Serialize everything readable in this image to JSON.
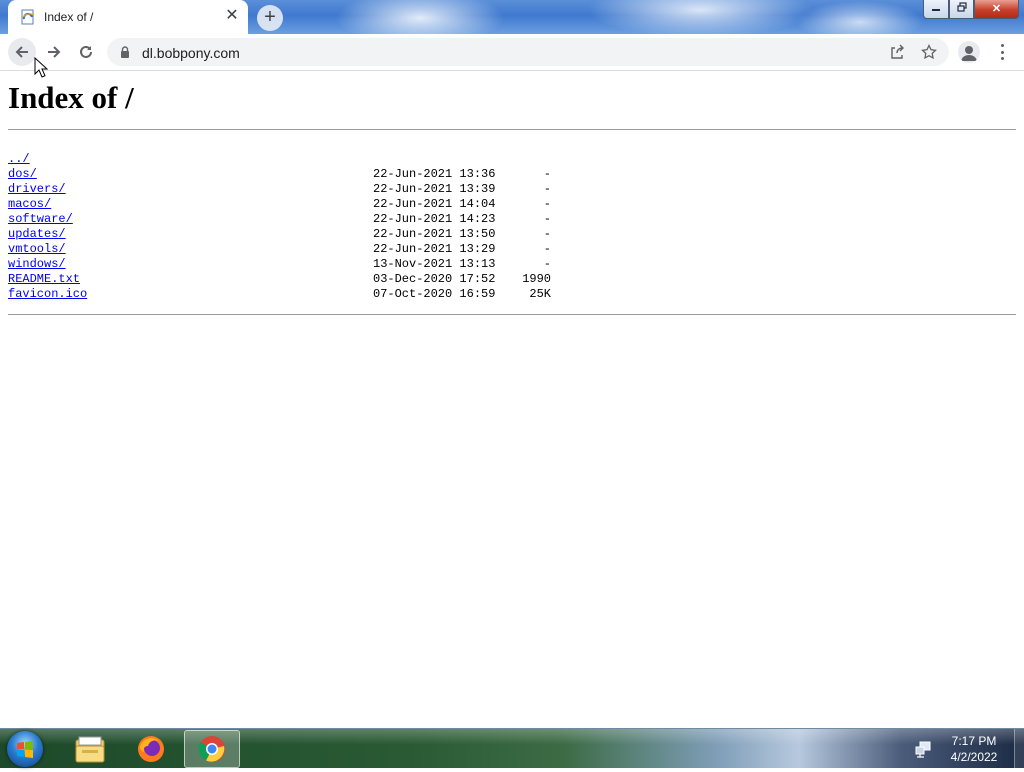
{
  "browser": {
    "tab": {
      "title": "Index of /",
      "favicon": "ie-document-icon"
    },
    "new_tab_label": "+",
    "omnibox": {
      "url": "dl.bobpony.com"
    },
    "window_controls": {
      "minimize": "minimize-icon",
      "maximize": "restore-icon",
      "close": "close-icon"
    }
  },
  "page": {
    "heading": "Index of /",
    "entries": [
      {
        "name": "../",
        "date": "",
        "size": ""
      },
      {
        "name": "dos/",
        "date": "22-Jun-2021 13:36",
        "size": "-"
      },
      {
        "name": "drivers/",
        "date": "22-Jun-2021 13:39",
        "size": "-"
      },
      {
        "name": "macos/",
        "date": "22-Jun-2021 14:04",
        "size": "-"
      },
      {
        "name": "software/",
        "date": "22-Jun-2021 14:23",
        "size": "-"
      },
      {
        "name": "updates/",
        "date": "22-Jun-2021 13:50",
        "size": "-"
      },
      {
        "name": "vmtools/",
        "date": "22-Jun-2021 13:29",
        "size": "-"
      },
      {
        "name": "windows/",
        "date": "13-Nov-2021 13:13",
        "size": "-"
      },
      {
        "name": "README.txt",
        "date": "03-Dec-2020 17:52",
        "size": "1990"
      },
      {
        "name": "favicon.ico",
        "date": "07-Oct-2020 16:59",
        "size": "25K"
      }
    ]
  },
  "taskbar": {
    "apps": [
      "windows-explorer-icon",
      "firefox-icon",
      "chrome-icon"
    ],
    "active_app": "chrome-icon",
    "clock": {
      "time": "7:17 PM",
      "date": "4/2/2022"
    }
  },
  "colors": {
    "link": "#0000ee",
    "omnibox_bg": "#f1f3f4",
    "close_button": "#c7402a"
  }
}
